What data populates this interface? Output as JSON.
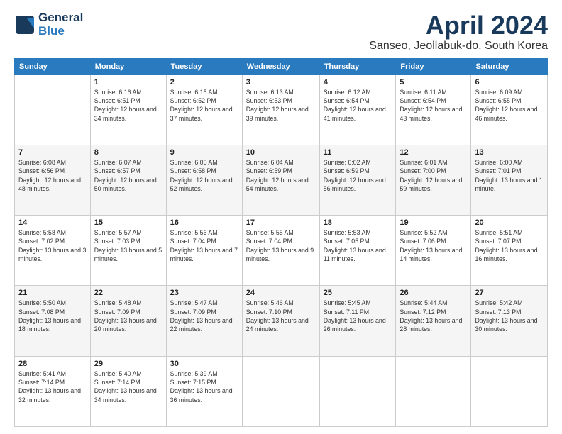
{
  "logo": {
    "general": "General",
    "blue": "Blue"
  },
  "header": {
    "month": "April 2024",
    "location": "Sanseo, Jeollabuk-do, South Korea"
  },
  "days_of_week": [
    "Sunday",
    "Monday",
    "Tuesday",
    "Wednesday",
    "Thursday",
    "Friday",
    "Saturday"
  ],
  "weeks": [
    [
      {
        "day": "",
        "sunrise": "",
        "sunset": "",
        "daylight": ""
      },
      {
        "day": "1",
        "sunrise": "Sunrise: 6:16 AM",
        "sunset": "Sunset: 6:51 PM",
        "daylight": "Daylight: 12 hours and 34 minutes."
      },
      {
        "day": "2",
        "sunrise": "Sunrise: 6:15 AM",
        "sunset": "Sunset: 6:52 PM",
        "daylight": "Daylight: 12 hours and 37 minutes."
      },
      {
        "day": "3",
        "sunrise": "Sunrise: 6:13 AM",
        "sunset": "Sunset: 6:53 PM",
        "daylight": "Daylight: 12 hours and 39 minutes."
      },
      {
        "day": "4",
        "sunrise": "Sunrise: 6:12 AM",
        "sunset": "Sunset: 6:54 PM",
        "daylight": "Daylight: 12 hours and 41 minutes."
      },
      {
        "day": "5",
        "sunrise": "Sunrise: 6:11 AM",
        "sunset": "Sunset: 6:54 PM",
        "daylight": "Daylight: 12 hours and 43 minutes."
      },
      {
        "day": "6",
        "sunrise": "Sunrise: 6:09 AM",
        "sunset": "Sunset: 6:55 PM",
        "daylight": "Daylight: 12 hours and 46 minutes."
      }
    ],
    [
      {
        "day": "7",
        "sunrise": "Sunrise: 6:08 AM",
        "sunset": "Sunset: 6:56 PM",
        "daylight": "Daylight: 12 hours and 48 minutes."
      },
      {
        "day": "8",
        "sunrise": "Sunrise: 6:07 AM",
        "sunset": "Sunset: 6:57 PM",
        "daylight": "Daylight: 12 hours and 50 minutes."
      },
      {
        "day": "9",
        "sunrise": "Sunrise: 6:05 AM",
        "sunset": "Sunset: 6:58 PM",
        "daylight": "Daylight: 12 hours and 52 minutes."
      },
      {
        "day": "10",
        "sunrise": "Sunrise: 6:04 AM",
        "sunset": "Sunset: 6:59 PM",
        "daylight": "Daylight: 12 hours and 54 minutes."
      },
      {
        "day": "11",
        "sunrise": "Sunrise: 6:02 AM",
        "sunset": "Sunset: 6:59 PM",
        "daylight": "Daylight: 12 hours and 56 minutes."
      },
      {
        "day": "12",
        "sunrise": "Sunrise: 6:01 AM",
        "sunset": "Sunset: 7:00 PM",
        "daylight": "Daylight: 12 hours and 59 minutes."
      },
      {
        "day": "13",
        "sunrise": "Sunrise: 6:00 AM",
        "sunset": "Sunset: 7:01 PM",
        "daylight": "Daylight: 13 hours and 1 minute."
      }
    ],
    [
      {
        "day": "14",
        "sunrise": "Sunrise: 5:58 AM",
        "sunset": "Sunset: 7:02 PM",
        "daylight": "Daylight: 13 hours and 3 minutes."
      },
      {
        "day": "15",
        "sunrise": "Sunrise: 5:57 AM",
        "sunset": "Sunset: 7:03 PM",
        "daylight": "Daylight: 13 hours and 5 minutes."
      },
      {
        "day": "16",
        "sunrise": "Sunrise: 5:56 AM",
        "sunset": "Sunset: 7:04 PM",
        "daylight": "Daylight: 13 hours and 7 minutes."
      },
      {
        "day": "17",
        "sunrise": "Sunrise: 5:55 AM",
        "sunset": "Sunset: 7:04 PM",
        "daylight": "Daylight: 13 hours and 9 minutes."
      },
      {
        "day": "18",
        "sunrise": "Sunrise: 5:53 AM",
        "sunset": "Sunset: 7:05 PM",
        "daylight": "Daylight: 13 hours and 11 minutes."
      },
      {
        "day": "19",
        "sunrise": "Sunrise: 5:52 AM",
        "sunset": "Sunset: 7:06 PM",
        "daylight": "Daylight: 13 hours and 14 minutes."
      },
      {
        "day": "20",
        "sunrise": "Sunrise: 5:51 AM",
        "sunset": "Sunset: 7:07 PM",
        "daylight": "Daylight: 13 hours and 16 minutes."
      }
    ],
    [
      {
        "day": "21",
        "sunrise": "Sunrise: 5:50 AM",
        "sunset": "Sunset: 7:08 PM",
        "daylight": "Daylight: 13 hours and 18 minutes."
      },
      {
        "day": "22",
        "sunrise": "Sunrise: 5:48 AM",
        "sunset": "Sunset: 7:09 PM",
        "daylight": "Daylight: 13 hours and 20 minutes."
      },
      {
        "day": "23",
        "sunrise": "Sunrise: 5:47 AM",
        "sunset": "Sunset: 7:09 PM",
        "daylight": "Daylight: 13 hours and 22 minutes."
      },
      {
        "day": "24",
        "sunrise": "Sunrise: 5:46 AM",
        "sunset": "Sunset: 7:10 PM",
        "daylight": "Daylight: 13 hours and 24 minutes."
      },
      {
        "day": "25",
        "sunrise": "Sunrise: 5:45 AM",
        "sunset": "Sunset: 7:11 PM",
        "daylight": "Daylight: 13 hours and 26 minutes."
      },
      {
        "day": "26",
        "sunrise": "Sunrise: 5:44 AM",
        "sunset": "Sunset: 7:12 PM",
        "daylight": "Daylight: 13 hours and 28 minutes."
      },
      {
        "day": "27",
        "sunrise": "Sunrise: 5:42 AM",
        "sunset": "Sunset: 7:13 PM",
        "daylight": "Daylight: 13 hours and 30 minutes."
      }
    ],
    [
      {
        "day": "28",
        "sunrise": "Sunrise: 5:41 AM",
        "sunset": "Sunset: 7:14 PM",
        "daylight": "Daylight: 13 hours and 32 minutes."
      },
      {
        "day": "29",
        "sunrise": "Sunrise: 5:40 AM",
        "sunset": "Sunset: 7:14 PM",
        "daylight": "Daylight: 13 hours and 34 minutes."
      },
      {
        "day": "30",
        "sunrise": "Sunrise: 5:39 AM",
        "sunset": "Sunset: 7:15 PM",
        "daylight": "Daylight: 13 hours and 36 minutes."
      },
      {
        "day": "",
        "sunrise": "",
        "sunset": "",
        "daylight": ""
      },
      {
        "day": "",
        "sunrise": "",
        "sunset": "",
        "daylight": ""
      },
      {
        "day": "",
        "sunrise": "",
        "sunset": "",
        "daylight": ""
      },
      {
        "day": "",
        "sunrise": "",
        "sunset": "",
        "daylight": ""
      }
    ]
  ]
}
